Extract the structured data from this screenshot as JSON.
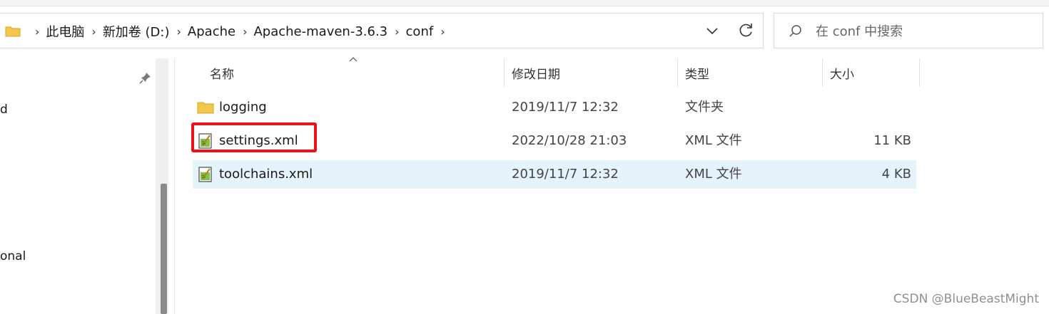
{
  "address_bar": {
    "crumbs": [
      "此电脑",
      "新加卷 (D:)",
      "Apache",
      "Apache-maven-3.6.3",
      "conf"
    ]
  },
  "search": {
    "placeholder": "在 conf 中搜索"
  },
  "nav_pane": {
    "items": [
      "d",
      "onal"
    ]
  },
  "columns": {
    "name": "名称",
    "date": "修改日期",
    "type": "类型",
    "size": "大小"
  },
  "files": [
    {
      "name": "logging",
      "date": "2019/11/7 12:32",
      "type": "文件夹",
      "size": "",
      "icon": "folder-icon"
    },
    {
      "name": "settings.xml",
      "date": "2022/10/28 21:03",
      "type": "XML 文件",
      "size": "11 KB",
      "icon": "xml-file-icon"
    },
    {
      "name": "toolchains.xml",
      "date": "2019/11/7 12:32",
      "type": "XML 文件",
      "size": "4 KB",
      "icon": "xml-file-icon"
    }
  ],
  "watermark": "CSDN @BlueBeastMight",
  "colors": {
    "highlight_box": "#e8141c",
    "selected_row": "#e5f3fb",
    "folder": "#f4c64b"
  }
}
